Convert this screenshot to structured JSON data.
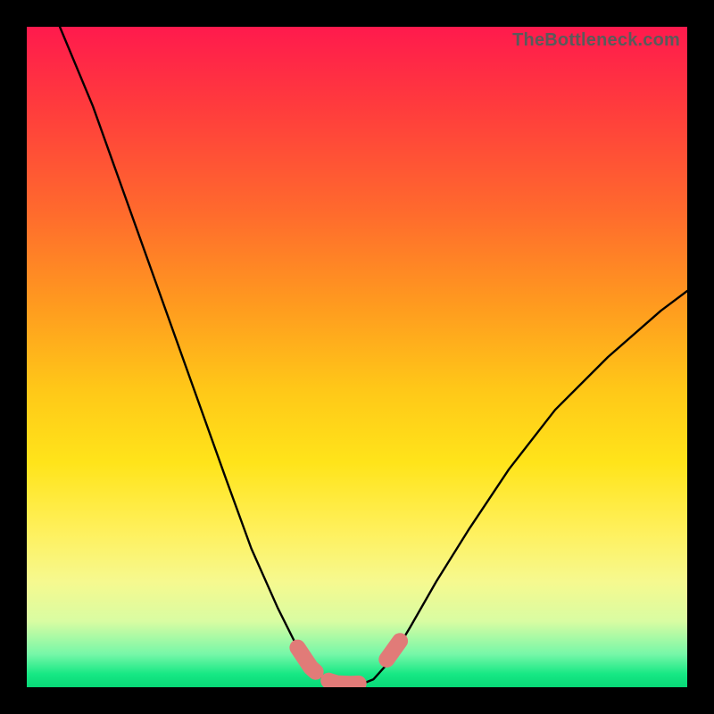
{
  "watermark": "TheBottleneck.com",
  "chart_data": {
    "type": "line",
    "title": "",
    "xlabel": "",
    "ylabel": "",
    "xlim": [
      0,
      100
    ],
    "ylim": [
      0,
      100
    ],
    "series": [
      {
        "name": "bottleneck-curve",
        "x": [
          5,
          10,
          15,
          20,
          25,
          30,
          34,
          38,
          41,
          43,
          45,
          47,
          49,
          51,
          52.5,
          55,
          58,
          62,
          67,
          73,
          80,
          88,
          96,
          100
        ],
        "y": [
          100,
          88,
          74,
          60,
          46,
          32,
          21,
          12,
          6,
          3,
          1.2,
          0.6,
          0.5,
          0.6,
          1.2,
          4,
          9,
          16,
          24,
          33,
          42,
          50,
          57,
          60
        ]
      },
      {
        "name": "highlight-segment",
        "x": [
          41,
          43,
          45,
          47,
          49,
          51,
          52.5
        ],
        "y": [
          6,
          3,
          1.2,
          0.6,
          0.5,
          0.6,
          1.2
        ]
      }
    ],
    "colors": {
      "curve": "#000000",
      "highlight": "#e17b78"
    }
  }
}
